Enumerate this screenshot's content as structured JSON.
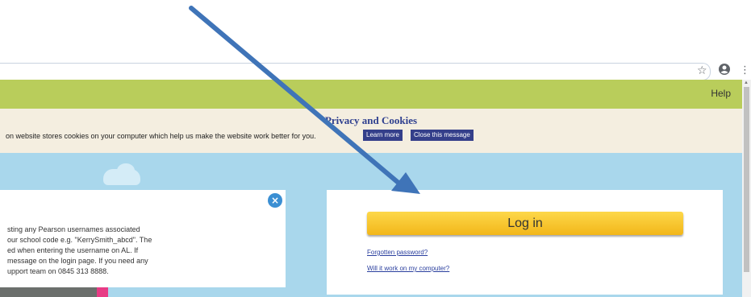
{
  "browser": {
    "star_icon": "star-icon",
    "account_icon": "account-circle-icon",
    "menu_icon": "more-vert-icon"
  },
  "header": {
    "help": "Help"
  },
  "cookie_banner": {
    "title": "Privacy and Cookies",
    "text": "on website stores cookies on your computer which help us make the website work better for you.",
    "learn_more": "Learn more",
    "close": "Close this message"
  },
  "info_box": {
    "lines": [
      "sting any Pearson usernames associated",
      "our school code e.g. \"KerrySmith_abcd\". The",
      "ed when entering the username on AL. If",
      "message on the login page. If you need any",
      "upport team on 0845 313 8888."
    ]
  },
  "login": {
    "button": "Log in",
    "forgot": "Forgotten password?",
    "compat": "Will it work on my computer?"
  },
  "colors": {
    "header_green": "#b9cd5b",
    "banner_bg": "#f4eee0",
    "button_navy": "#343f8a",
    "sky": "#a9d7ec",
    "login_yellow": "#f9c935",
    "arrow_blue": "#3f74b8"
  }
}
